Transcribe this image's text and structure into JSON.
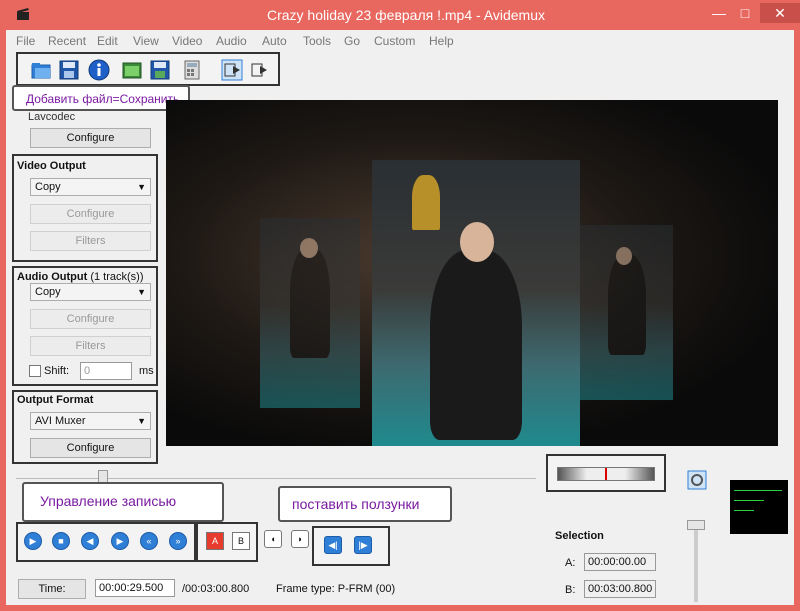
{
  "window": {
    "title": "Crazy holiday 23 февраля !.mp4 - Avidemux",
    "min_glyph": "—",
    "max_glyph": "□",
    "close_glyph": "✕"
  },
  "menu": [
    "File",
    "Recent",
    "Edit",
    "View",
    "Video",
    "Audio",
    "Auto",
    "Tools",
    "Go",
    "Custom",
    "Help"
  ],
  "toolbar": {
    "icons": [
      "open-folder-icon",
      "save-disk-icon",
      "info-icon",
      "open-image-icon",
      "save-image-icon",
      "calculator-icon",
      "play-input-icon",
      "play-output-icon"
    ]
  },
  "tooltip_text": "Добавить  файл=Сохранить",
  "video_decoder": {
    "name": "Lavcodec",
    "configure": "Configure"
  },
  "video_output": {
    "title": "Video Output",
    "codec": "Copy",
    "configure": "Configure",
    "filters": "Filters"
  },
  "audio_output": {
    "title": "Audio Output",
    "tracks": "(1 track(s))",
    "codec": "Copy",
    "configure": "Configure",
    "filters": "Filters",
    "shift_label": "Shift:",
    "shift_value": "0",
    "shift_unit": "ms"
  },
  "output_format": {
    "title": "Output Format",
    "muxer": "AVI Muxer",
    "configure": "Configure"
  },
  "callouts": {
    "recording": "Управление  записью",
    "sliders": "поставить  ползунки"
  },
  "playback_controls": {
    "icons": [
      "play-icon",
      "stop-icon",
      "previous-frame-icon",
      "next-frame-icon",
      "rewind-icon",
      "fast-forward-icon"
    ],
    "marker_a": "A",
    "marker_b": "B"
  },
  "status": {
    "time_button": "Time:",
    "current_time": "00:00:29.500",
    "total_time": "/00:03:00.800",
    "frame_type": "Frame type:  P-FRM (00)"
  },
  "selection": {
    "title": "Selection",
    "a_label": "A:",
    "a_value": "00:00:00.00",
    "b_label": "B:",
    "b_value": "00:03:00.800"
  },
  "colors": {
    "titlebar": "#e8675f",
    "accent_blue": "#2f7fd6",
    "callout_text": "#7a1aa0"
  }
}
